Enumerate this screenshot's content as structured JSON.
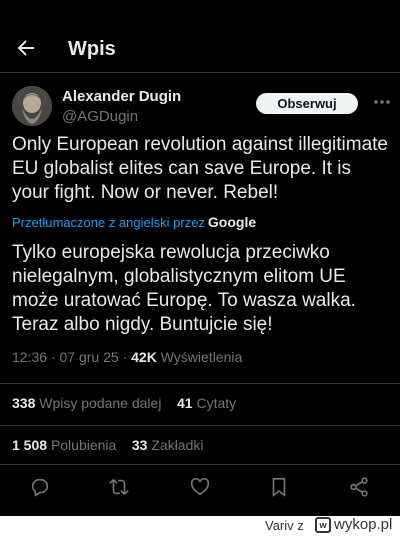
{
  "header": {
    "title": "Wpis"
  },
  "author": {
    "name": "Alexander Dugin",
    "handle": "@AGDugin"
  },
  "follow_label": "Obserwuj",
  "tweet": {
    "text": "Only European revolution against illegitimate EU globalist elites can save Europe. It is your fight. Now or never. Rebel!",
    "translated_label": "Przetłumaczone z angielski przez",
    "translator": "Google",
    "translated_text": "Tylko europejska rewolucja przeciwko nielegalnym, globalistycznym elitom UE może uratować Europę. To wasza walka. Teraz albo nigdy. Buntujcie się!"
  },
  "meta": {
    "time": "12:36",
    "date": "07 gru 25",
    "views": "42K",
    "views_label": "Wyświetlenia"
  },
  "stats": {
    "retweets": "338",
    "retweets_label": "Wpisy podane dalej",
    "quotes": "41",
    "quotes_label": "Cytaty",
    "likes": "1 508",
    "likes_label": "Polubienia",
    "bookmarks": "33",
    "bookmarks_label": "Zakładki"
  },
  "actions": [
    "reply-icon",
    "retweet-icon",
    "like-icon",
    "bookmark-icon",
    "share-icon"
  ],
  "watermark": {
    "user": "Variv z",
    "brand": "wykop.pl"
  },
  "colors": {
    "background": "#000000",
    "text": "#e7e9ea",
    "secondary": "#71767b",
    "link": "#1d9bf0",
    "divider": "#2f3336"
  }
}
